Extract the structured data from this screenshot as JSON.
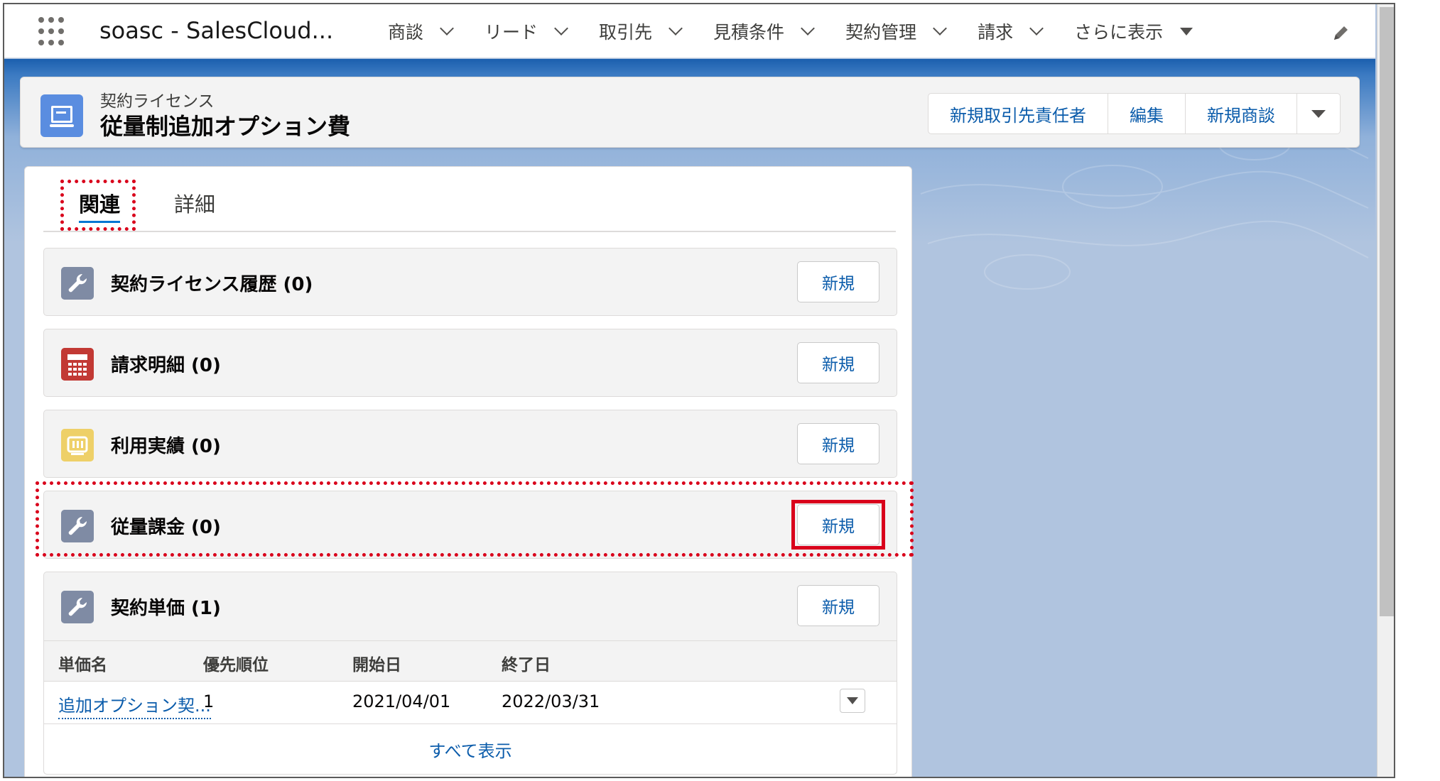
{
  "nav": {
    "app_name": "soasc - SalesCloud...",
    "items": [
      {
        "label": "商談"
      },
      {
        "label": "リード"
      },
      {
        "label": "取引先"
      },
      {
        "label": "見積条件"
      },
      {
        "label": "契約管理"
      },
      {
        "label": "請求"
      }
    ],
    "more_label": "さらに表示",
    "icons": [
      "app-launcher-icon",
      "chevron-down-icon",
      "pencil-icon"
    ]
  },
  "record": {
    "type_label": "契約ライセンス",
    "title": "従量制追加オプション費",
    "icon": "record-icon",
    "actions": [
      {
        "label": "新規取引先責任者"
      },
      {
        "label": "編集"
      },
      {
        "label": "新規商談"
      }
    ]
  },
  "tabs": [
    {
      "label": "関連",
      "active": true
    },
    {
      "label": "詳細",
      "active": false
    }
  ],
  "related_lists": [
    {
      "title": "契約ライセンス履歴 (0)",
      "icon": "wrench-icon",
      "new_label": "新規"
    },
    {
      "title": "請求明細 (0)",
      "icon": "calculator-icon",
      "new_label": "新規"
    },
    {
      "title": "利用実績 (0)",
      "icon": "usage-icon",
      "new_label": "新規"
    },
    {
      "title": "従量課金 (0)",
      "icon": "wrench-icon",
      "new_label": "新規"
    },
    {
      "title": "契約単価 (1)",
      "icon": "wrench-icon",
      "new_label": "新規",
      "columns": [
        "単価名",
        "優先順位",
        "開始日",
        "終了日"
      ],
      "rows": [
        {
          "name": "追加オプション契...",
          "priority": "1",
          "start": "2021/04/01",
          "end": "2022/03/31"
        }
      ],
      "view_all_label": "すべて表示"
    }
  ],
  "colors": {
    "accent": "#0176d3",
    "link": "#0b5cab",
    "highlight_red": "#d9001b",
    "record_icon": "#5a8de0",
    "wrench_icon_bg": "#7f8ba4",
    "calc_icon_bg": "#c23934",
    "usage_icon_bg": "#eed068"
  }
}
